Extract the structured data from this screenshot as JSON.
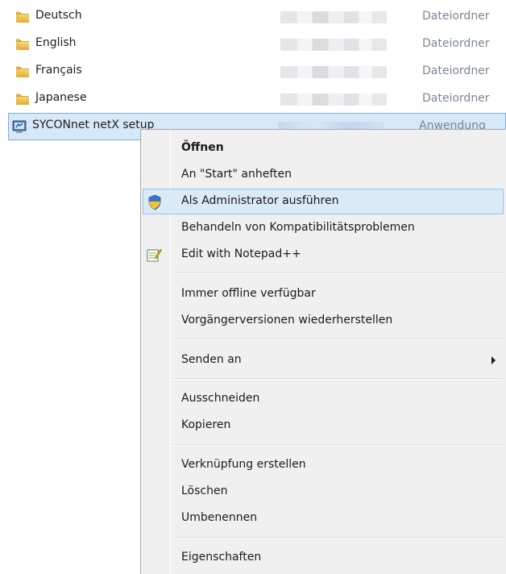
{
  "files": [
    {
      "name": "Deutsch",
      "type": "Dateiordner",
      "icon": "folder-icon"
    },
    {
      "name": "English",
      "type": "Dateiordner",
      "icon": "folder-icon"
    },
    {
      "name": "Français",
      "type": "Dateiordner",
      "icon": "folder-icon"
    },
    {
      "name": "Japanese",
      "type": "Dateiordner",
      "icon": "folder-icon"
    },
    {
      "name": "SYCONnet netX setup",
      "type": "Anwendung",
      "icon": "installer-app-icon"
    }
  ],
  "context_menu": {
    "items": [
      {
        "label": "Öffnen"
      },
      {
        "label": "An \"Start\" anheften"
      },
      {
        "label": "Als Administrator ausführen",
        "icon": "uac-shield-icon"
      },
      {
        "label": "Behandeln von Kompatibilitätsproblemen"
      },
      {
        "label": "Edit with Notepad++",
        "icon": "notepad-plus-plus-icon"
      },
      {
        "label": "Immer offline verfügbar"
      },
      {
        "label": "Vorgängerversionen wiederherstellen"
      },
      {
        "label": "Senden an",
        "icon": "submenu-arrow-icon"
      },
      {
        "label": "Ausschneiden"
      },
      {
        "label": "Kopieren"
      },
      {
        "label": "Verknüpfung erstellen"
      },
      {
        "label": "Löschen"
      },
      {
        "label": "Umbenennen"
      },
      {
        "label": "Eigenschaften"
      }
    ]
  },
  "colors": {
    "selection_bg": "#d7e8f8",
    "selection_border": "#84acdd",
    "menu_bg": "#f0f0f0",
    "menu_highlight": "#dbeaf7",
    "type_text": "#7a8594"
  }
}
